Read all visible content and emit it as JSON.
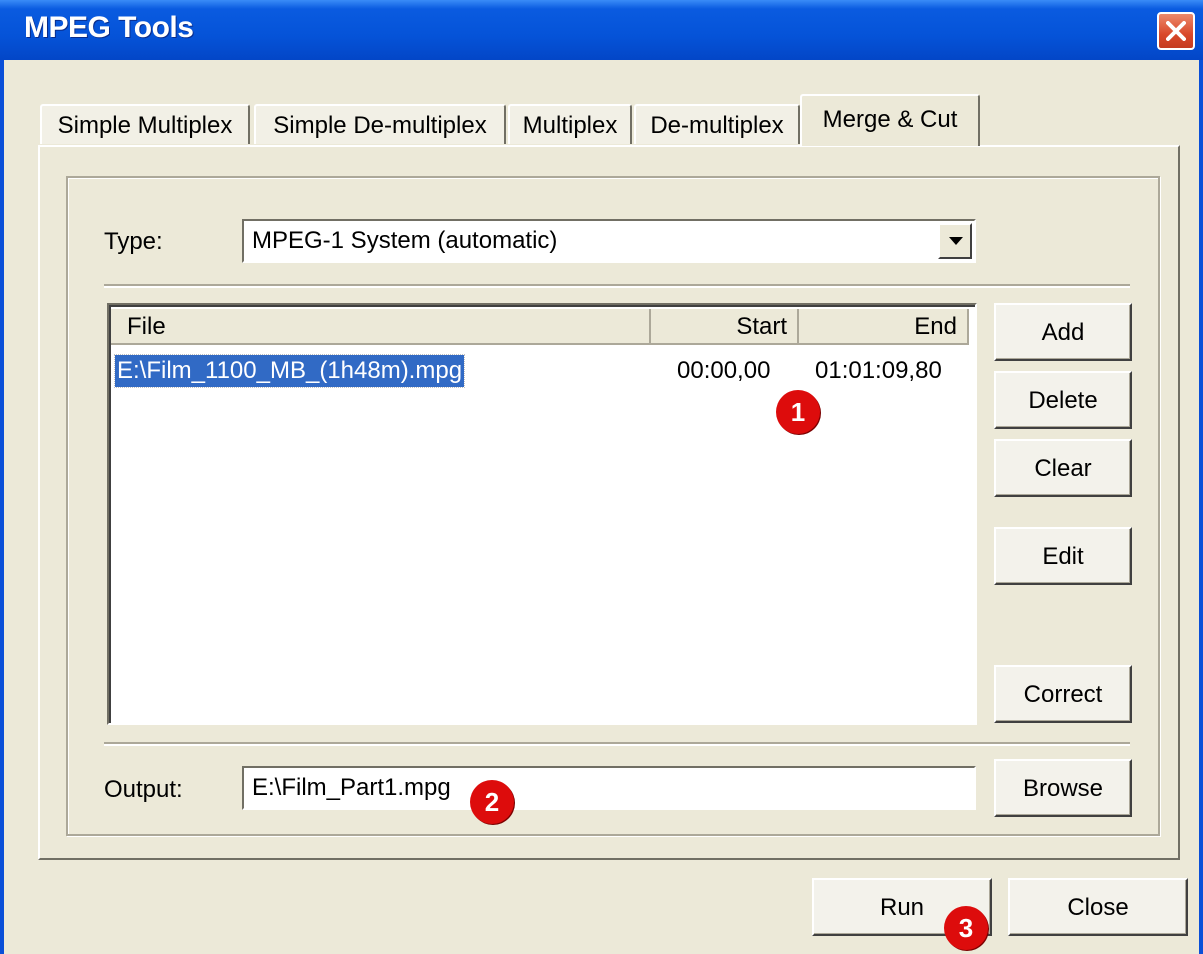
{
  "window": {
    "title": "MPEG Tools"
  },
  "tabs": [
    {
      "label": "Simple Multiplex",
      "active": false
    },
    {
      "label": "Simple De-multiplex",
      "active": false
    },
    {
      "label": "Multiplex",
      "active": false
    },
    {
      "label": "De-multiplex",
      "active": false
    },
    {
      "label": "Merge & Cut",
      "active": true
    }
  ],
  "type_field": {
    "label": "Type:",
    "value": "MPEG-1 System (automatic)"
  },
  "file_list": {
    "columns": [
      "File",
      "Start",
      "End"
    ],
    "rows": [
      {
        "file": "E:\\Film_1100_MB_(1h48m).mpg",
        "start": "00:00,00",
        "end": "01:01:09,80",
        "selected": true
      }
    ]
  },
  "side_buttons": {
    "add": "Add",
    "delete": "Delete",
    "clear": "Clear",
    "edit": "Edit",
    "correct": "Correct"
  },
  "output_field": {
    "label": "Output:",
    "value": "E:\\Film_Part1.mpg",
    "browse": "Browse"
  },
  "footer_buttons": {
    "run": "Run",
    "close": "Close"
  },
  "annotations": [
    "1",
    "2",
    "3"
  ],
  "colors": {
    "titlebar": "#0553d8",
    "selection": "#316ac5",
    "badge": "#dd0c0c",
    "face": "#ece9d8"
  }
}
